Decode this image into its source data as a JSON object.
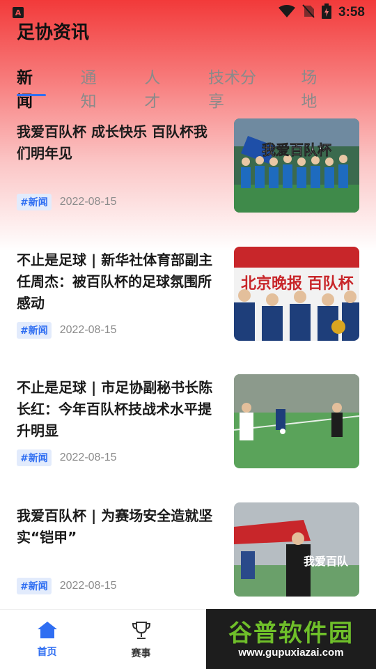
{
  "status_bar": {
    "time": "3:58",
    "app_badge": "A"
  },
  "header": {
    "title": "足协资讯"
  },
  "tabs": [
    {
      "label": "新闻",
      "active": true
    },
    {
      "label": "通知",
      "active": false
    },
    {
      "label": "人才",
      "active": false
    },
    {
      "label": "技术分享",
      "active": false
    },
    {
      "label": "场地",
      "active": false
    }
  ],
  "news": [
    {
      "title": "我爱百队杯 成长快乐 百队杯我们明年见",
      "tag": "#新闻",
      "date": "2022-08-15",
      "thumb_caption": "我爱百队杯"
    },
    {
      "title": "不止是足球 | 新华社体育部副主任周杰：被百队杯的足球氛围所感动",
      "tag": "#新闻",
      "date": "2022-08-15",
      "thumb_caption": "北京晚报 百队杯"
    },
    {
      "title": "不止是足球 | 市足协副秘书长陈长红：今年百队杯技战术水平提升明显",
      "tag": "#新闻",
      "date": "2022-08-15",
      "thumb_caption": ""
    },
    {
      "title": "我爱百队杯 | 为赛场安全造就坚实“铠甲”",
      "tag": "#新闻",
      "date": "2022-08-15",
      "thumb_caption": "我爱百队"
    }
  ],
  "bottom_nav": [
    {
      "label": "首页",
      "icon": "home-icon",
      "active": true
    },
    {
      "label": "赛事",
      "icon": "trophy-icon",
      "active": false
    }
  ],
  "watermark": {
    "main": "谷普软件园",
    "sub": "www.gupuxiazai.com"
  },
  "colors": {
    "accent": "#2f6ef2",
    "header_red": "#f23a3a",
    "tag_bg": "#e2ebfc"
  }
}
